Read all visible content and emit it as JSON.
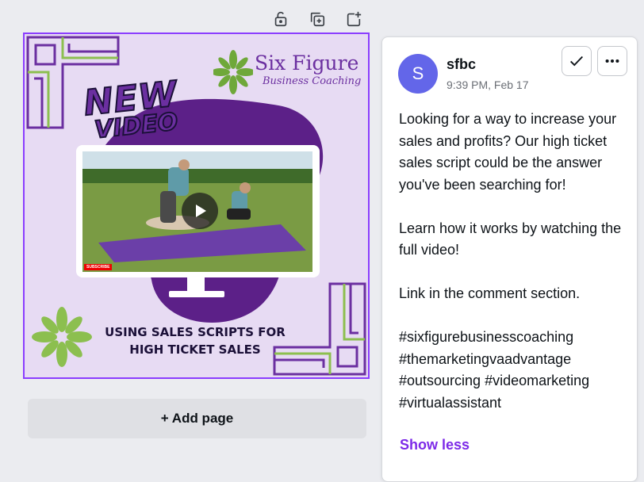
{
  "toolbar": {
    "icons": [
      "unlock-icon",
      "duplicate-page-icon",
      "add-page-icon"
    ]
  },
  "design": {
    "logo_title": "Six Figure",
    "logo_subtitle": "Business Coaching",
    "headline_line1": "NEW",
    "headline_line2": "VIDEO",
    "video_badge": "SUBSCRIBE",
    "caption_line1": "USING SALES SCRIPTS FOR",
    "caption_line2": "HIGH TICKET SALES",
    "colors": {
      "background": "#e7dbf3",
      "purple": "#5c2088",
      "green": "#8cbf4f",
      "frame_purple": "#8b52c4"
    }
  },
  "add_page": {
    "label": "+ Add page"
  },
  "comment_panel": {
    "avatar_letter": "S",
    "username": "sfbc",
    "timestamp": "9:39 PM, Feb 17",
    "paragraphs": [
      "Looking for a way to increase your sales and profits? Our high ticket sales script could be the answer you've been searching for!",
      "Learn how it works by watching the full video!",
      "Link in the comment section."
    ],
    "hashtags": [
      "#sixfigurebusinesscoaching",
      "#themarketingvaadvantage",
      "#outsourcing #videomarketing",
      "#virtualassistant"
    ],
    "show_less": "Show less",
    "accent_color": "#7d2ae8"
  }
}
